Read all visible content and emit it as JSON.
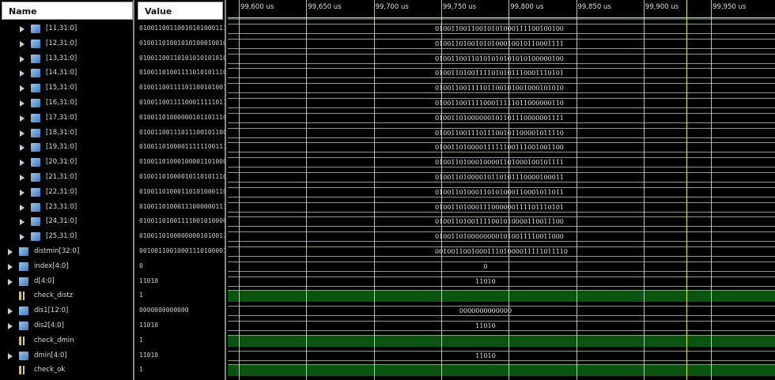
{
  "columns": {
    "name": "Name",
    "value": "Value"
  },
  "timeline": {
    "ticks": [
      "99,600 us",
      "99,650 us",
      "99,700 us",
      "99,750 us",
      "99,800 us",
      "99,850 us",
      "99,900 us",
      "99,950 us"
    ]
  },
  "colors": {
    "high": "#0b5410",
    "cursor": "#e8e860"
  },
  "signals": [
    {
      "name": "[11,31:0]",
      "value": "01001100110010101000111100100100",
      "type": "bus",
      "indent": 1
    },
    {
      "name": "[12,31:0]",
      "value": "01001101001010100010010110001111",
      "type": "bus",
      "indent": 1
    },
    {
      "name": "[13,31:0]",
      "value": "01001100110101010101010100000100",
      "type": "bus",
      "indent": 1
    },
    {
      "name": "[14,31:0]",
      "value": "01001101001111010101110001110101",
      "type": "bus",
      "indent": 1
    },
    {
      "name": "[15,31:0]",
      "value": "01001100111101100101001000101010",
      "type": "bus",
      "indent": 1
    },
    {
      "name": "[16,31:0]",
      "value": "01001100111100011111011000000110",
      "type": "bus",
      "indent": 1
    },
    {
      "name": "[17,31:0]",
      "value": "01001101000000101101110000001111",
      "type": "bus",
      "indent": 1
    },
    {
      "name": "[18,31:0]",
      "value": "01001100111011100101100001011110",
      "type": "bus",
      "indent": 1
    },
    {
      "name": "[19,31:0]",
      "value": "01001101000011111100111001001100",
      "type": "bus",
      "indent": 1
    },
    {
      "name": "[20,31:0]",
      "value": "01001101000100001101000100101111",
      "type": "bus",
      "indent": 1
    },
    {
      "name": "[21,31:0]",
      "value": "01001101000010110101110000100011",
      "type": "bus",
      "indent": 1
    },
    {
      "name": "[22,31:0]",
      "value": "01001101000110101000110001011011",
      "type": "bus",
      "indent": 1
    },
    {
      "name": "[23,31:0]",
      "value": "01001101000111000000111101110101",
      "type": "bus",
      "indent": 1
    },
    {
      "name": "[24,31:0]",
      "value": "01001101001111001010000110011100",
      "type": "bus",
      "indent": 1
    },
    {
      "name": "[25,31:0]",
      "value": "01001101000000001010011110011000",
      "type": "bus",
      "indent": 1
    },
    {
      "name": "distmin[32:0]",
      "value": "001001100100011101000011111011110",
      "type": "bus",
      "indent": 0
    },
    {
      "name": "index[4:0]",
      "value": "0",
      "type": "bus",
      "indent": 0,
      "centered": true
    },
    {
      "name": "d[4:0]",
      "value": "11010",
      "type": "bus",
      "indent": 0,
      "centered": true
    },
    {
      "name": "check_distz",
      "value": "1",
      "type": "bit",
      "indent": 0
    },
    {
      "name": "dis1[12:0]",
      "value": "0000000000000",
      "type": "bus",
      "indent": 0,
      "centered": true
    },
    {
      "name": "dis2[4:0]",
      "value": "11010",
      "type": "bus",
      "indent": 0,
      "centered": true
    },
    {
      "name": "check_dmin",
      "value": "1",
      "type": "bit",
      "indent": 0
    },
    {
      "name": "dmin[4:0]",
      "value": "11010",
      "type": "bus",
      "indent": 0,
      "centered": true
    },
    {
      "name": "check_ok",
      "value": "1",
      "type": "bit",
      "indent": 0
    }
  ]
}
